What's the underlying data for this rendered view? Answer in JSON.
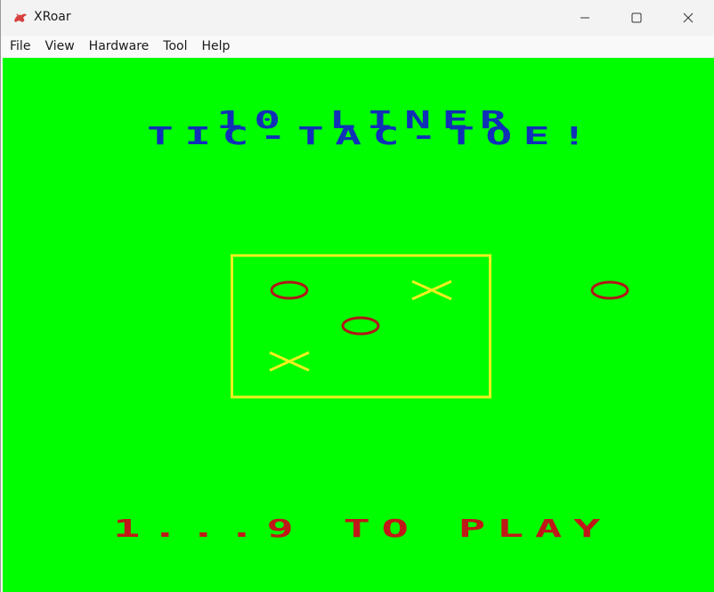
{
  "window": {
    "title": "XRoar",
    "icon": "xroar-dragon-icon",
    "controls": [
      "minimize-icon",
      "maximize-icon",
      "close-icon"
    ]
  },
  "menubar": {
    "items": [
      {
        "label": "File"
      },
      {
        "label": "View"
      },
      {
        "label": "Hardware"
      },
      {
        "label": "Tool"
      },
      {
        "label": "Help"
      }
    ]
  },
  "game": {
    "title_line1": "10 LINER",
    "title_line2": "TIC-TAC-TOE!",
    "prompt": "1...9 TO PLAY",
    "board": [
      [
        "O",
        "",
        "X"
      ],
      [
        "",
        "O",
        ""
      ],
      [
        "X",
        "",
        ""
      ]
    ],
    "next_piece": "O",
    "colors": {
      "background": "#00fe00",
      "title": "#1030b8",
      "prompt": "#c01818",
      "board_frame": "#f0f020",
      "o_piece": "#b01818",
      "x_piece": "#f0f020"
    }
  }
}
